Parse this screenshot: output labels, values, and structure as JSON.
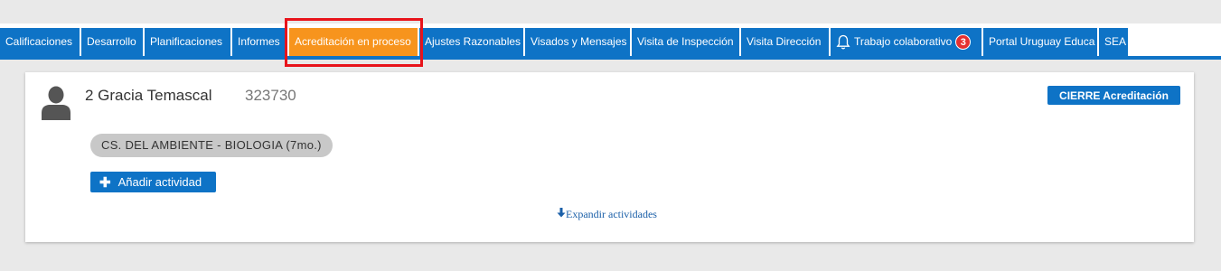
{
  "tabs": [
    {
      "label": "Calificaciones"
    },
    {
      "label": "Desarrollo"
    },
    {
      "label": "Planificaciones"
    },
    {
      "label": "Informes"
    },
    {
      "label": "Acreditación en proceso"
    },
    {
      "label": "Ajustes Razonables"
    },
    {
      "label": "Visados y Mensajes"
    },
    {
      "label": "Visita de Inspección"
    },
    {
      "label": "Visita Dirección"
    },
    {
      "label": "Trabajo colaborativo",
      "badge": "3"
    },
    {
      "label": "Portal Uruguay Educa"
    },
    {
      "label": "SEA"
    }
  ],
  "student": {
    "name": "2 Gracia Temascal",
    "id": "323730"
  },
  "close_button": "CIERRE Acreditación",
  "subject": "CS. DEL AMBIENTE - BIOLOGIA (7mo.)",
  "add_activity": "Añadir actividad",
  "expand_activities": "Expandir actividades",
  "colors": {
    "tab_blue": "#0e73c6",
    "tab_active_orange": "#f7941d",
    "highlight_red": "#e8141b",
    "badge_red": "#e53030"
  },
  "icons": {
    "user": "user-silhouette-icon",
    "bell": "bell-icon",
    "plus": "plus-icon",
    "arrow": "arrow-down-icon"
  }
}
